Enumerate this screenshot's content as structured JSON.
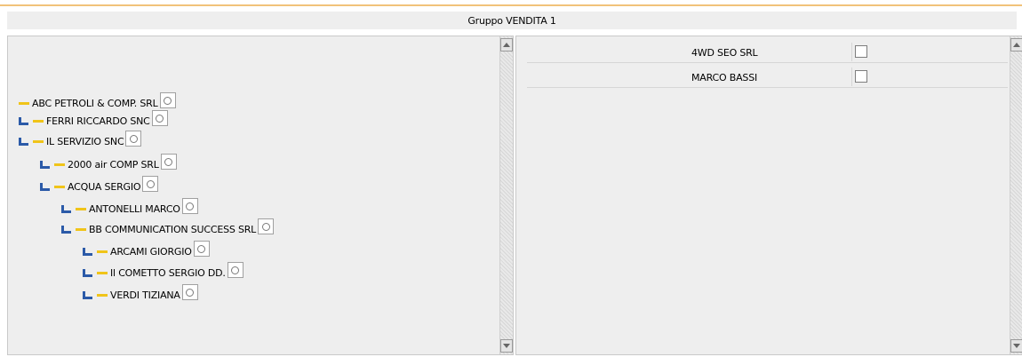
{
  "header": {
    "title": "Gruppo VENDITA 1"
  },
  "colors": {
    "accent_line": "#f1c27a",
    "tree_bar": "#f0c419",
    "tree_elbow": "#2b5aa8",
    "panel_bg": "#eeeeee"
  },
  "tree": {
    "items": [
      {
        "label": "ABC PETROLI & COMP. SRL",
        "level": 0,
        "elbow": false
      },
      {
        "label": "FERRI RICCARDO SNC",
        "level": 0,
        "elbow": true
      },
      {
        "label": "IL SERVIZIO SNC",
        "level": 0,
        "elbow": true
      },
      {
        "label": "2000 air COMP SRL",
        "level": 1,
        "elbow": true
      },
      {
        "label": "ACQUA SERGIO",
        "level": 1,
        "elbow": true
      },
      {
        "label": "ANTONELLI MARCO",
        "level": 2,
        "elbow": true
      },
      {
        "label": "BB COMMUNICATION SUCCESS SRL",
        "level": 2,
        "elbow": true
      },
      {
        "label": "ARCAMI GIORGIO",
        "level": 3,
        "elbow": true
      },
      {
        "label": "Il COMETTO SERGIO DD.",
        "level": 3,
        "elbow": true
      },
      {
        "label": "VERDI TIZIANA",
        "level": 3,
        "elbow": true
      }
    ]
  },
  "list": {
    "items": [
      {
        "name": "4WD SEO SRL",
        "checked": false
      },
      {
        "name": "MARCO BASSI",
        "checked": false
      }
    ]
  },
  "icons": {
    "tree_bar": "dash-icon",
    "tree_elbow": "elbow-icon",
    "radio": "radio-icon",
    "scroll_up": "arrow-up-icon",
    "scroll_down": "arrow-down-icon"
  }
}
